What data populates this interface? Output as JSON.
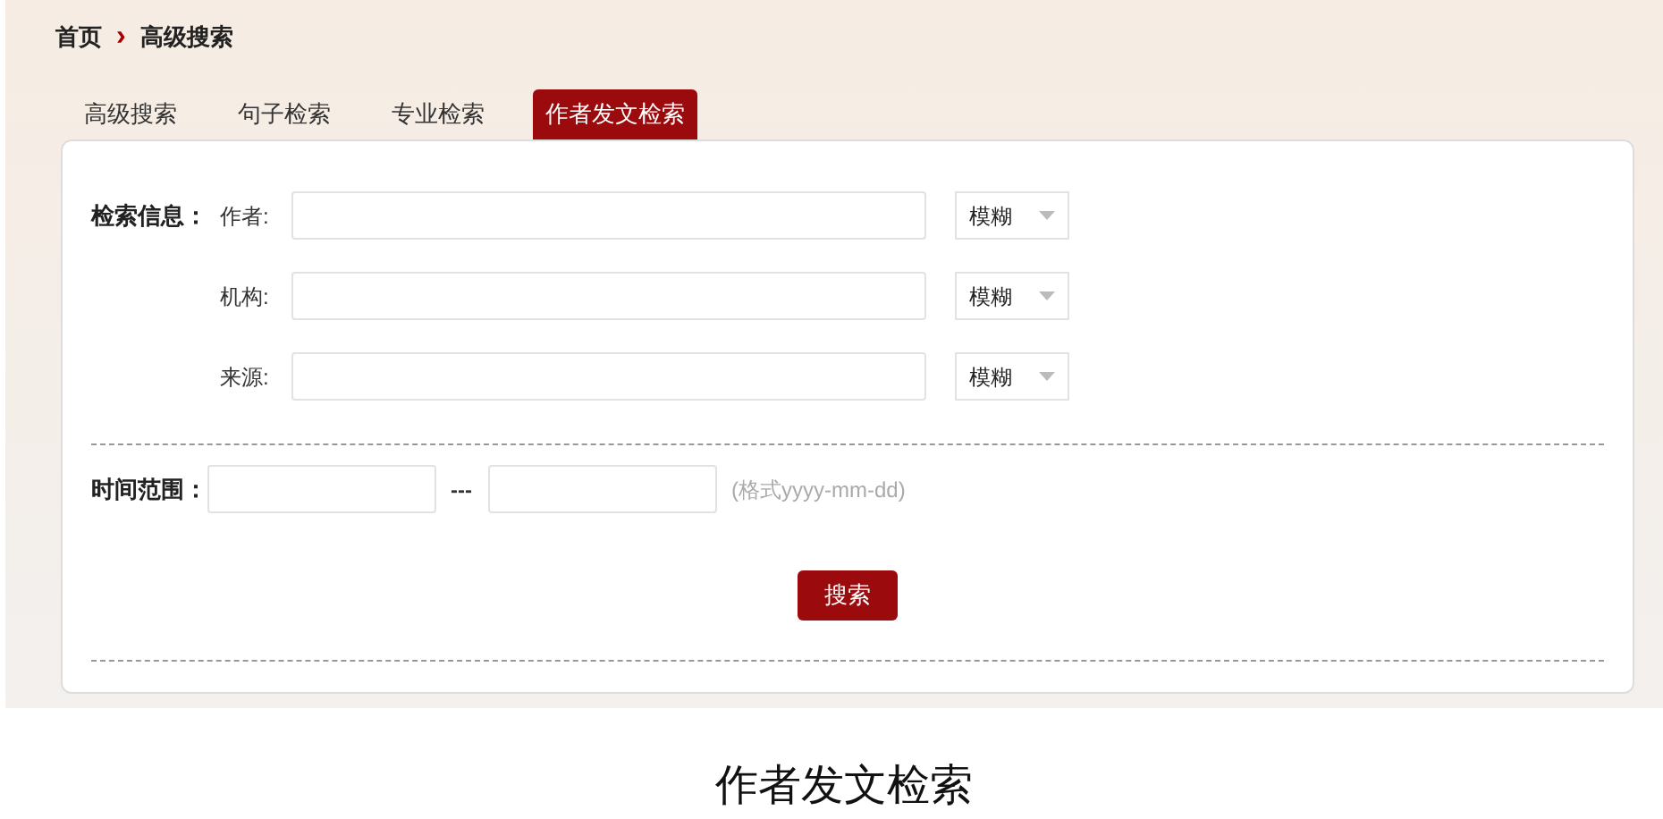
{
  "breadcrumb": {
    "home": "首页",
    "separator": "›",
    "current": "高级搜索"
  },
  "tabs": [
    {
      "label": "高级搜索",
      "selected": false
    },
    {
      "label": "句子检索",
      "selected": false
    },
    {
      "label": "专业检索",
      "selected": false
    },
    {
      "label": "作者发文检索",
      "selected": true
    }
  ],
  "search_info": {
    "label": "检索信息：",
    "fields": [
      {
        "label": "作者:",
        "match": "模糊"
      },
      {
        "label": "机构:",
        "match": "模糊"
      },
      {
        "label": "来源:",
        "match": "模糊"
      }
    ]
  },
  "time_range": {
    "label": "时间范围：",
    "separator": "---",
    "hint": "(格式yyyy-mm-dd)"
  },
  "search_button": "搜索",
  "caption": "作者发文检索"
}
